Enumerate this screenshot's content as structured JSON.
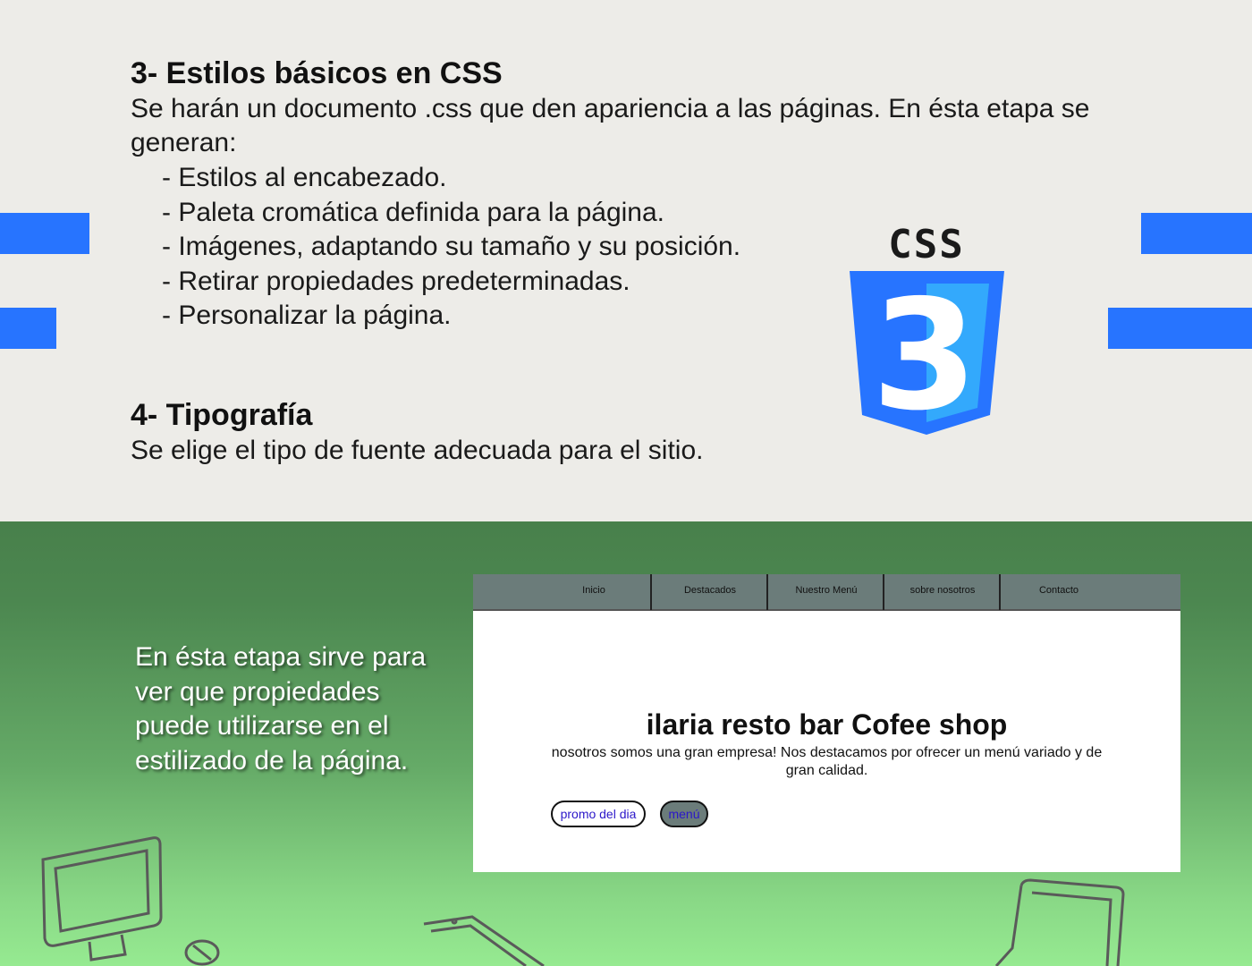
{
  "section3": {
    "title": "3- Estilos básicos en CSS",
    "intro_line1": "Se harán un documento .css que den apariencia a las páginas. En ésta etapa se",
    "intro_line2": "generan:",
    "items": [
      "- Estilos al encabezado.",
      "- Paleta cromática definida para la página.",
      "- Imágenes, adaptando su tamaño y su posición.",
      "- Retirar propiedades predeterminadas.",
      "- Personalizar la página."
    ]
  },
  "section4": {
    "title": "4- Tipografía",
    "text": "Se elige el tipo de fuente adecuada para el sitio."
  },
  "logo": {
    "label": "CSS",
    "numeral": "3",
    "icon": "css3-logo-icon",
    "colors": {
      "shield_dark": "#2774ff",
      "shield_light": "#33a9fc"
    }
  },
  "green_section": {
    "line1": "En ésta etapa sirve para",
    "line2": "ver que propiedades",
    "line3": "puede utilizarse en el",
    "line4": "estilizado de la página."
  },
  "mockup": {
    "nav": [
      "Inicio",
      "Destacados",
      "Nuestro Menú",
      "sobre nosotros",
      "Contacto"
    ],
    "title": "ilaria resto bar Cofee shop",
    "description": "nosotros somos una gran empresa! Nos destacamos por ofrecer un menú variado y de gran calidad.",
    "buttons": {
      "promo": "promo del dia",
      "menu": "menú"
    }
  },
  "colors": {
    "accent_blue": "#2774ff",
    "top_bg": "#edece8",
    "nav_bg": "#6b7c7a",
    "link_color": "#2b17c9"
  }
}
